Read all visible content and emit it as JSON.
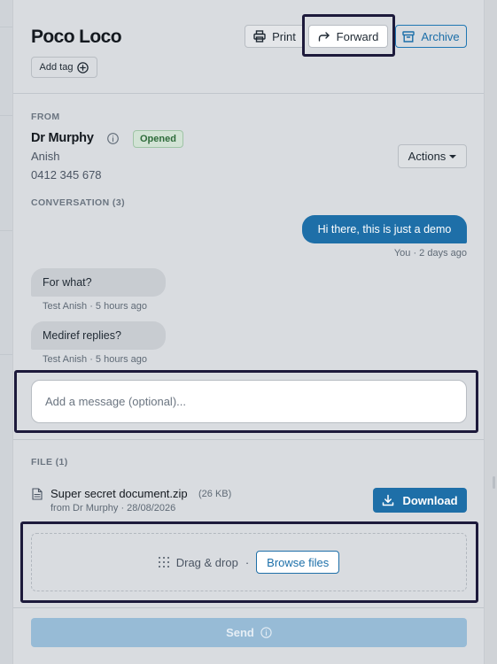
{
  "header": {
    "title": "Poco Loco",
    "print_label": "Print",
    "forward_label": "Forward",
    "archive_label": "Archive",
    "add_tag_label": "Add tag"
  },
  "from": {
    "section_label": "FROM",
    "name": "Dr Murphy",
    "status": "Opened",
    "subname": "Anish",
    "phone": "0412 345 678",
    "actions_label": "Actions"
  },
  "conversation": {
    "section_label": "CONVERSATION (3)",
    "messages": [
      {
        "text": "Hi there, this is just a demo",
        "meta": "You · 2 days ago",
        "direction": "outgoing"
      },
      {
        "text": "For what?",
        "meta": "Test Anish · 5 hours ago",
        "direction": "incoming"
      },
      {
        "text": "Mediref replies?",
        "meta": "Test Anish · 5 hours ago",
        "direction": "incoming"
      }
    ]
  },
  "message_input": {
    "placeholder": "Add a message (optional)...",
    "value": ""
  },
  "files": {
    "section_label": "FILE (1)",
    "items": [
      {
        "name": "Super secret document.zip",
        "size": "(26 KB)",
        "from": "from Dr Murphy · 28/08/2026",
        "download_label": "Download"
      }
    ]
  },
  "dropzone": {
    "drag_label": "Drag & drop",
    "separator": "·",
    "browse_label": "Browse files"
  },
  "send": {
    "label": "Send",
    "disabled": true
  },
  "colors": {
    "accent": "#1e6fa8",
    "badge_bg": "#d2e3d5",
    "badge_text": "#2e6b3a",
    "highlight_border": "#1d1a3b",
    "send_disabled": "#97bbd6"
  },
  "icons": [
    "printer-icon",
    "forward-arrow-icon",
    "archive-box-icon",
    "plus-circle-icon",
    "info-icon",
    "caret-down-icon",
    "file-icon",
    "download-icon",
    "grip-dots-icon",
    "send-info-icon"
  ]
}
